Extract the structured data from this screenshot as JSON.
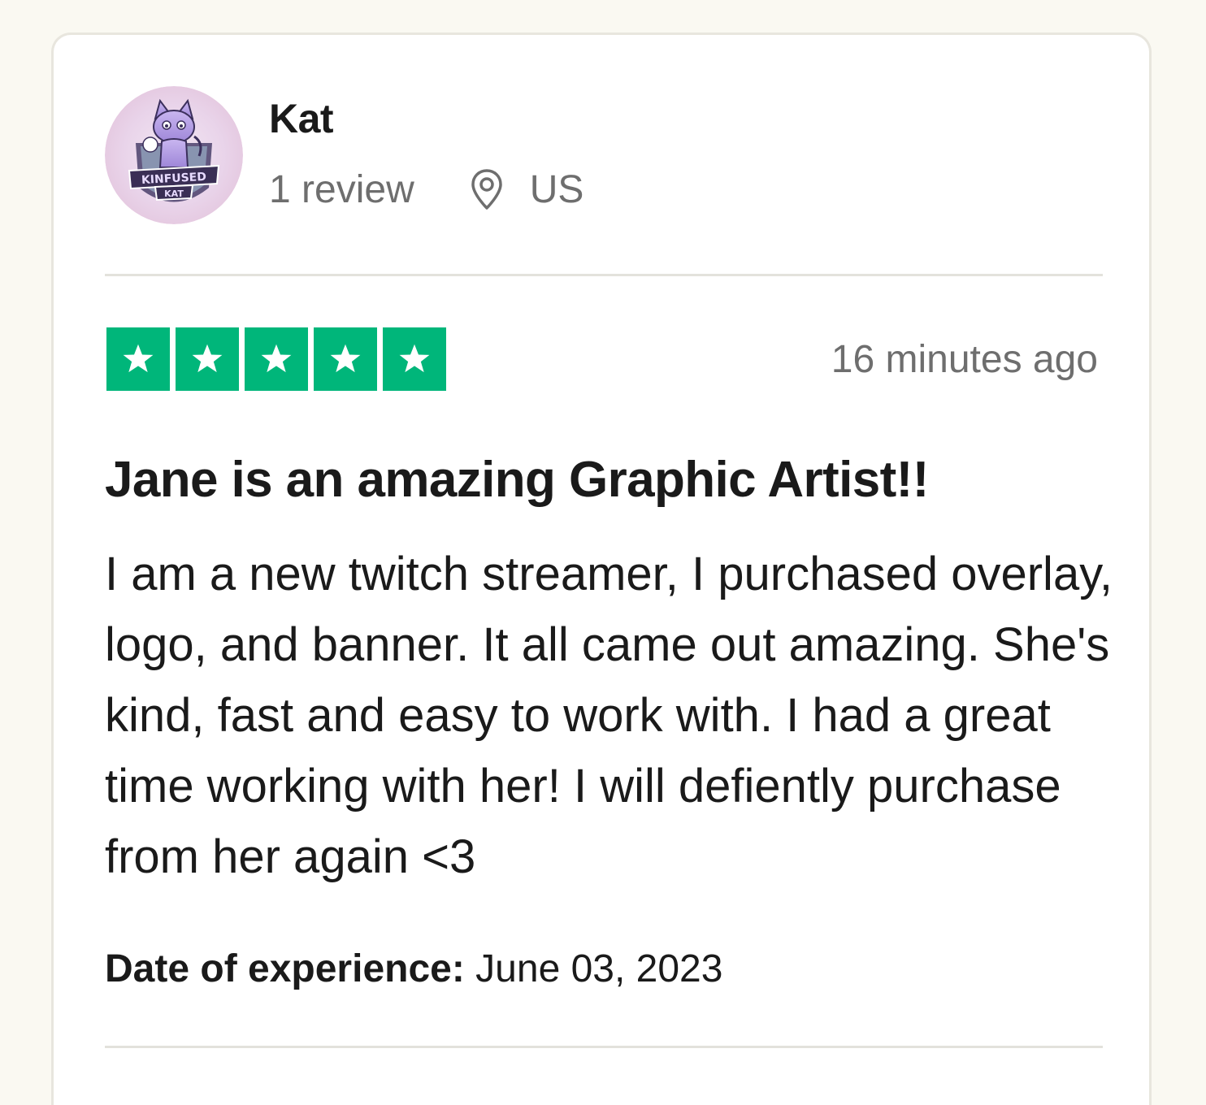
{
  "reviewer": {
    "name": "Kat",
    "review_count": "1 review",
    "country": "US",
    "avatar_icon": "cat-mascot-avatar"
  },
  "rating": {
    "stars": 5,
    "max_stars": 5,
    "star_color": "#00b67a"
  },
  "review": {
    "time_ago": "16 minutes ago",
    "title": "Jane is an amazing Graphic Artist!!",
    "body": "I am a new twitch streamer, I purchased overlay, logo, and banner. It all came out amazing. She's kind, fast and easy to work with. I had a great time working with her! I will defiently purchase from her again <3",
    "experience_label": "Date of experience:",
    "experience_date": "June 03, 2023"
  },
  "colors": {
    "background": "#faf9f2",
    "card": "#ffffff",
    "muted_text": "#6e6e6e",
    "accent": "#00b67a"
  }
}
